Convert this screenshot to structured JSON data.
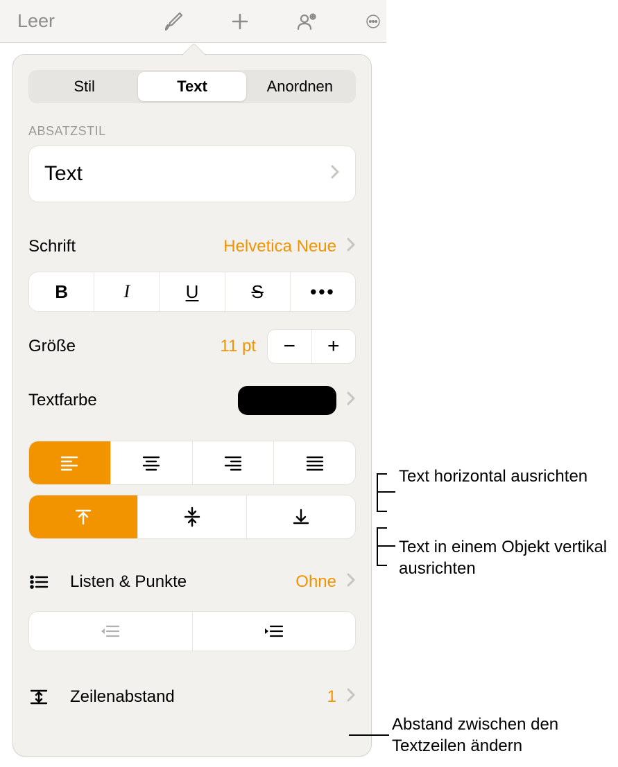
{
  "colors": {
    "accent": "#f29400",
    "swatch": "#000000"
  },
  "toolbar": {
    "title": "Leer",
    "icons": {
      "paintbrush": "paintbrush-icon",
      "plus": "plus-icon",
      "collaborate": "collaborate-icon",
      "more": "more-icon"
    }
  },
  "tabs": {
    "items": [
      {
        "label": "Stil",
        "active": false
      },
      {
        "label": "Text",
        "active": true
      },
      {
        "label": "Anordnen",
        "active": false
      }
    ]
  },
  "paragraph": {
    "heading": "ABSATZSTIL",
    "style_name": "Text"
  },
  "font": {
    "label": "Schrift",
    "value": "Helvetica Neue",
    "buttons": {
      "bold": "B",
      "italic": "I",
      "underline": "U",
      "strike": "S",
      "more": "•••"
    }
  },
  "size": {
    "label": "Größe",
    "value": "11 pt"
  },
  "textcolor": {
    "label": "Textfarbe"
  },
  "alignment": {
    "horizontal": [
      "left",
      "center",
      "right",
      "justify"
    ],
    "horizontal_active": 0,
    "vertical": [
      "top",
      "middle",
      "bottom"
    ],
    "vertical_active": 0
  },
  "lists": {
    "label": "Listen & Punkte",
    "value": "Ohne"
  },
  "indent": {
    "decrease": "decrease-indent",
    "increase": "increase-indent"
  },
  "linespacing": {
    "label": "Zeilenabstand",
    "value": "1"
  },
  "callouts": {
    "h_align": "Text horizontal ausrichten",
    "v_align": "Text in einem Objekt vertikal ausrichten",
    "spacing": "Abstand zwischen den Textzeilen ändern"
  }
}
